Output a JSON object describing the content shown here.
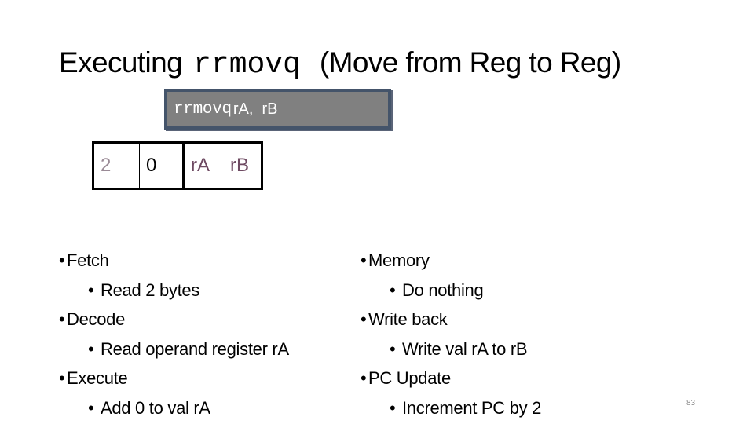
{
  "title": {
    "prefix": "Executing",
    "instruction": "rrmovq",
    "suffix": "(Move from Reg to Reg)"
  },
  "instruction_box": {
    "mnemonic": "rrmovq",
    "operands": "rA,  rB"
  },
  "encoding": {
    "cells": [
      "2",
      "0",
      "rA",
      "rB"
    ],
    "colors": {
      "icode": "#9a8a96",
      "ifun": "#000000",
      "registers": "#6e4a62",
      "box_border": "#44546a",
      "box_fill": "#808080"
    }
  },
  "stages_left": [
    {
      "name": "Fetch",
      "detail": "Read 2 bytes"
    },
    {
      "name": "Decode",
      "detail": "Read operand register rA"
    },
    {
      "name": "Execute",
      "detail": "Add 0 to val rA"
    }
  ],
  "stages_right": [
    {
      "name": "Memory",
      "detail": "Do nothing"
    },
    {
      "name": "Write back",
      "detail": "Write val rA to rB"
    },
    {
      "name": "PC Update",
      "detail": "Increment PC by 2"
    }
  ],
  "bullet_glyph": "•",
  "page_number": "83"
}
